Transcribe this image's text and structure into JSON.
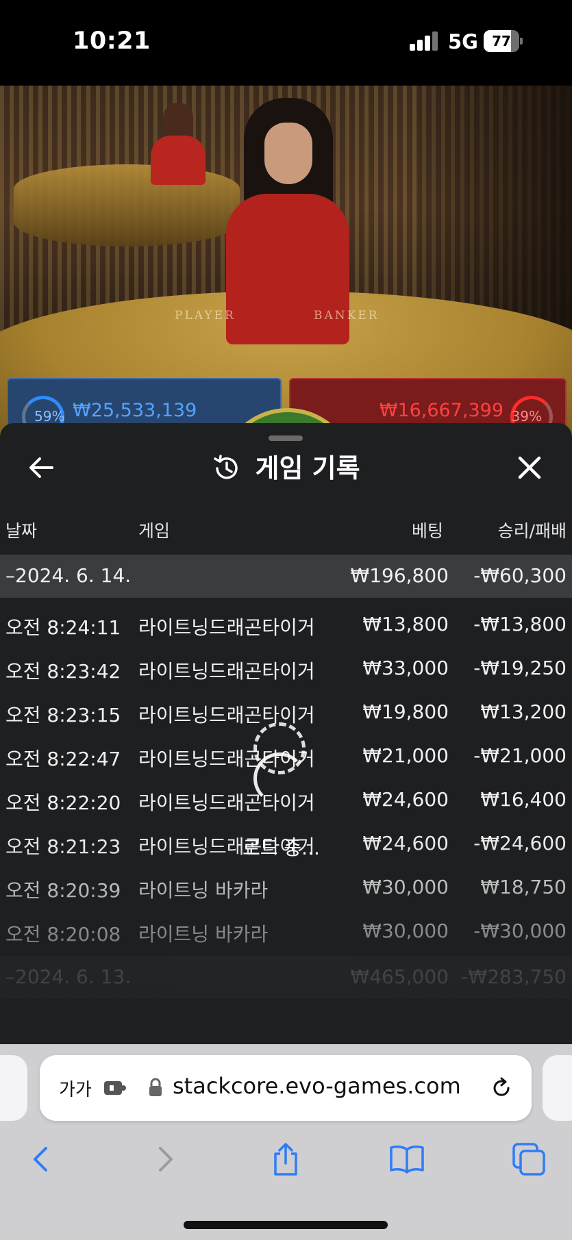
{
  "status_bar": {
    "time": "10:21",
    "network": "5G",
    "battery_level": "77",
    "battery_fraction": 0.77
  },
  "table": {
    "player_label": "PLAYER",
    "banker_label": "BANKER"
  },
  "bets": {
    "player_percent": "59%",
    "player_amount": "₩25,533,139",
    "banker_percent": "39%",
    "banker_amount": "₩16,667,399",
    "player_color": "#2f8bff",
    "banker_color": "#ff2a2a"
  },
  "history_panel": {
    "title": "게임 기록",
    "icons": {
      "back": "back-arrow-icon",
      "title": "history-icon",
      "close": "close-icon"
    },
    "columns": {
      "date": "날짜",
      "game": "게임",
      "bet": "베팅",
      "win_loss": "승리/패배"
    },
    "groups": [
      {
        "date": "–2024. 6. 14.",
        "bet_total": "₩196,800",
        "win_total": "-₩60,300",
        "rows": [
          {
            "time": "오전 8:24:11",
            "game": "라이트닝드래곤타이거",
            "bet": "₩13,800",
            "result": "-₩13,800"
          },
          {
            "time": "오전 8:23:42",
            "game": "라이트닝드래곤타이거",
            "bet": "₩33,000",
            "result": "-₩19,250"
          },
          {
            "time": "오전 8:23:15",
            "game": "라이트닝드래곤타이거",
            "bet": "₩19,800",
            "result": "₩13,200"
          },
          {
            "time": "오전 8:22:47",
            "game": "라이트닝드래곤타이거",
            "bet": "₩21,000",
            "result": "-₩21,000"
          },
          {
            "time": "오전 8:22:20",
            "game": "라이트닝드래곤타이거",
            "bet": "₩24,600",
            "result": "₩16,400"
          },
          {
            "time": "오전 8:21:23",
            "game": "라이트닝드래곤타이거",
            "bet": "₩24,600",
            "result": "-₩24,600"
          },
          {
            "time": "오전 8:20:39",
            "game": "라이트닝 바카라",
            "bet": "₩30,000",
            "result": "₩18,750"
          },
          {
            "time": "오전 8:20:08",
            "game": "라이트닝 바카라",
            "bet": "₩30,000",
            "result": "-₩30,000"
          }
        ]
      },
      {
        "date": "–2024. 6. 13.",
        "bet_total": "₩465,000",
        "win_total": "-₩283,750",
        "rows": []
      }
    ],
    "loading_text": "로드 중..."
  },
  "browser": {
    "text_size_label": "가가",
    "url": "stackcore.evo-games.com",
    "icons": {
      "extension": "extension-icon",
      "lock": "lock-icon",
      "reload": "reload-icon",
      "back": "back-icon",
      "forward": "forward-icon",
      "share": "share-icon",
      "bookmarks": "bookmarks-icon",
      "tabs": "tabs-icon"
    },
    "accent_color": "#2f7cf6"
  }
}
